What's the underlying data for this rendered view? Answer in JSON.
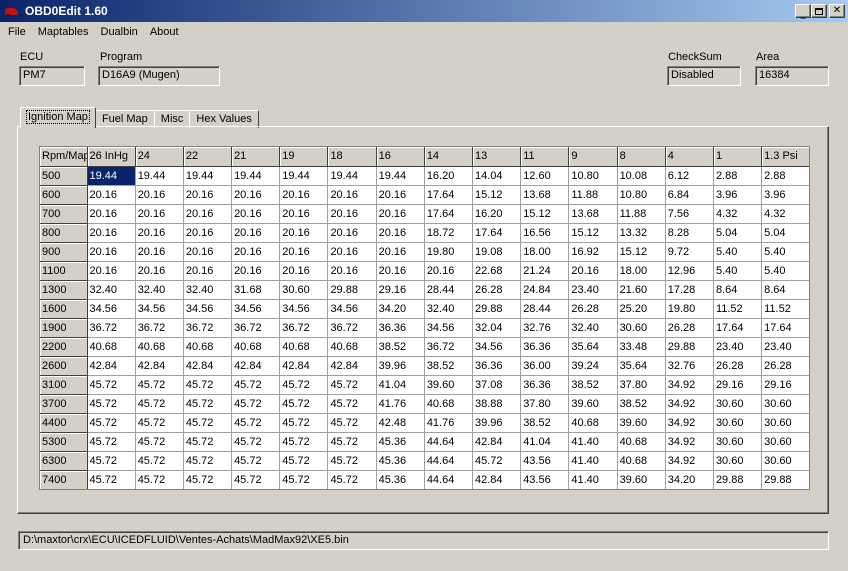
{
  "window": {
    "title": "OBD0Edit 1.60"
  },
  "menu": [
    "File",
    "Maptables",
    "Dualbin",
    "About"
  ],
  "fields": {
    "ecu": {
      "label": "ECU",
      "value": "PM7"
    },
    "program": {
      "label": "Program",
      "value": "D16A9 (Mugen)"
    },
    "checksum": {
      "label": "CheckSum",
      "value": "Disabled"
    },
    "area": {
      "label": "Area",
      "value": "16384"
    }
  },
  "tabs": [
    "Ignition Map",
    "Fuel Map",
    "Misc",
    "Hex Values"
  ],
  "grid": {
    "corner": "Rpm/Map",
    "columns": [
      "26 InHg",
      "24",
      "22",
      "21",
      "19",
      "18",
      "16",
      "14",
      "13",
      "11",
      "9",
      "8",
      "4",
      "1",
      "1.3 Psi"
    ],
    "rows": [
      {
        "rpm": "500",
        "values": [
          "19.44",
          "19.44",
          "19.44",
          "19.44",
          "19.44",
          "19.44",
          "19.44",
          "16.20",
          "14.04",
          "12.60",
          "10.80",
          "10.08",
          "6.12",
          "2.88",
          "2.88"
        ]
      },
      {
        "rpm": "600",
        "values": [
          "20.16",
          "20.16",
          "20.16",
          "20.16",
          "20.16",
          "20.16",
          "20.16",
          "17.64",
          "15.12",
          "13.68",
          "11.88",
          "10.80",
          "6.84",
          "3.96",
          "3.96"
        ]
      },
      {
        "rpm": "700",
        "values": [
          "20.16",
          "20.16",
          "20.16",
          "20.16",
          "20.16",
          "20.16",
          "20.16",
          "17.64",
          "16.20",
          "15.12",
          "13.68",
          "11.88",
          "7.56",
          "4.32",
          "4.32"
        ]
      },
      {
        "rpm": "800",
        "values": [
          "20.16",
          "20.16",
          "20.16",
          "20.16",
          "20.16",
          "20.16",
          "20.16",
          "18.72",
          "17.64",
          "16.56",
          "15.12",
          "13.32",
          "8.28",
          "5.04",
          "5.04"
        ]
      },
      {
        "rpm": "900",
        "values": [
          "20.16",
          "20.16",
          "20.16",
          "20.16",
          "20.16",
          "20.16",
          "20.16",
          "19.80",
          "19.08",
          "18.00",
          "16.92",
          "15.12",
          "9.72",
          "5.40",
          "5.40"
        ]
      },
      {
        "rpm": "1100",
        "values": [
          "20.16",
          "20.16",
          "20.16",
          "20.16",
          "20.16",
          "20.16",
          "20.16",
          "20.16",
          "22.68",
          "21.24",
          "20.16",
          "18.00",
          "12.96",
          "5.40",
          "5.40"
        ]
      },
      {
        "rpm": "1300",
        "values": [
          "32.40",
          "32.40",
          "32.40",
          "31.68",
          "30.60",
          "29.88",
          "29.16",
          "28.44",
          "26.28",
          "24.84",
          "23.40",
          "21.60",
          "17.28",
          "8.64",
          "8.64"
        ]
      },
      {
        "rpm": "1600",
        "values": [
          "34.56",
          "34.56",
          "34.56",
          "34.56",
          "34.56",
          "34.56",
          "34.20",
          "32.40",
          "29.88",
          "28.44",
          "26.28",
          "25.20",
          "19.80",
          "11.52",
          "11.52"
        ]
      },
      {
        "rpm": "1900",
        "values": [
          "36.72",
          "36.72",
          "36.72",
          "36.72",
          "36.72",
          "36.72",
          "36.36",
          "34.56",
          "32.04",
          "32.76",
          "32.40",
          "30.60",
          "26.28",
          "17.64",
          "17.64"
        ]
      },
      {
        "rpm": "2200",
        "values": [
          "40.68",
          "40.68",
          "40.68",
          "40.68",
          "40.68",
          "40.68",
          "38.52",
          "36.72",
          "34.56",
          "36.36",
          "35.64",
          "33.48",
          "29.88",
          "23.40",
          "23.40"
        ]
      },
      {
        "rpm": "2600",
        "values": [
          "42.84",
          "42.84",
          "42.84",
          "42.84",
          "42.84",
          "42.84",
          "39.96",
          "38.52",
          "36.36",
          "36.00",
          "39.24",
          "35.64",
          "32.76",
          "26.28",
          "26.28"
        ]
      },
      {
        "rpm": "3100",
        "values": [
          "45.72",
          "45.72",
          "45.72",
          "45.72",
          "45.72",
          "45.72",
          "41.04",
          "39.60",
          "37.08",
          "36.36",
          "38.52",
          "37.80",
          "34.92",
          "29.16",
          "29.16"
        ]
      },
      {
        "rpm": "3700",
        "values": [
          "45.72",
          "45.72",
          "45.72",
          "45.72",
          "45.72",
          "45.72",
          "41.76",
          "40.68",
          "38.88",
          "37.80",
          "39.60",
          "38.52",
          "34.92",
          "30.60",
          "30.60"
        ]
      },
      {
        "rpm": "4400",
        "values": [
          "45.72",
          "45.72",
          "45.72",
          "45.72",
          "45.72",
          "45.72",
          "42.48",
          "41.76",
          "39.96",
          "38.52",
          "40.68",
          "39.60",
          "34.92",
          "30.60",
          "30.60"
        ]
      },
      {
        "rpm": "5300",
        "values": [
          "45.72",
          "45.72",
          "45.72",
          "45.72",
          "45.72",
          "45.72",
          "45.36",
          "44.64",
          "42.84",
          "41.04",
          "41.40",
          "40.68",
          "34.92",
          "30.60",
          "30.60"
        ]
      },
      {
        "rpm": "6300",
        "values": [
          "45.72",
          "45.72",
          "45.72",
          "45.72",
          "45.72",
          "45.72",
          "45.36",
          "44.64",
          "45.72",
          "43.56",
          "41.40",
          "40.68",
          "34.92",
          "30.60",
          "30.60"
        ]
      },
      {
        "rpm": "7400",
        "values": [
          "45.72",
          "45.72",
          "45.72",
          "45.72",
          "45.72",
          "45.72",
          "45.36",
          "44.64",
          "42.84",
          "43.56",
          "41.40",
          "39.60",
          "34.20",
          "29.88",
          "29.88"
        ]
      }
    ]
  },
  "status": {
    "path": "D:\\maxtor\\crx\\ECU\\ICEDFLUID\\Ventes-Achats\\MadMax92\\XE5.bin"
  }
}
